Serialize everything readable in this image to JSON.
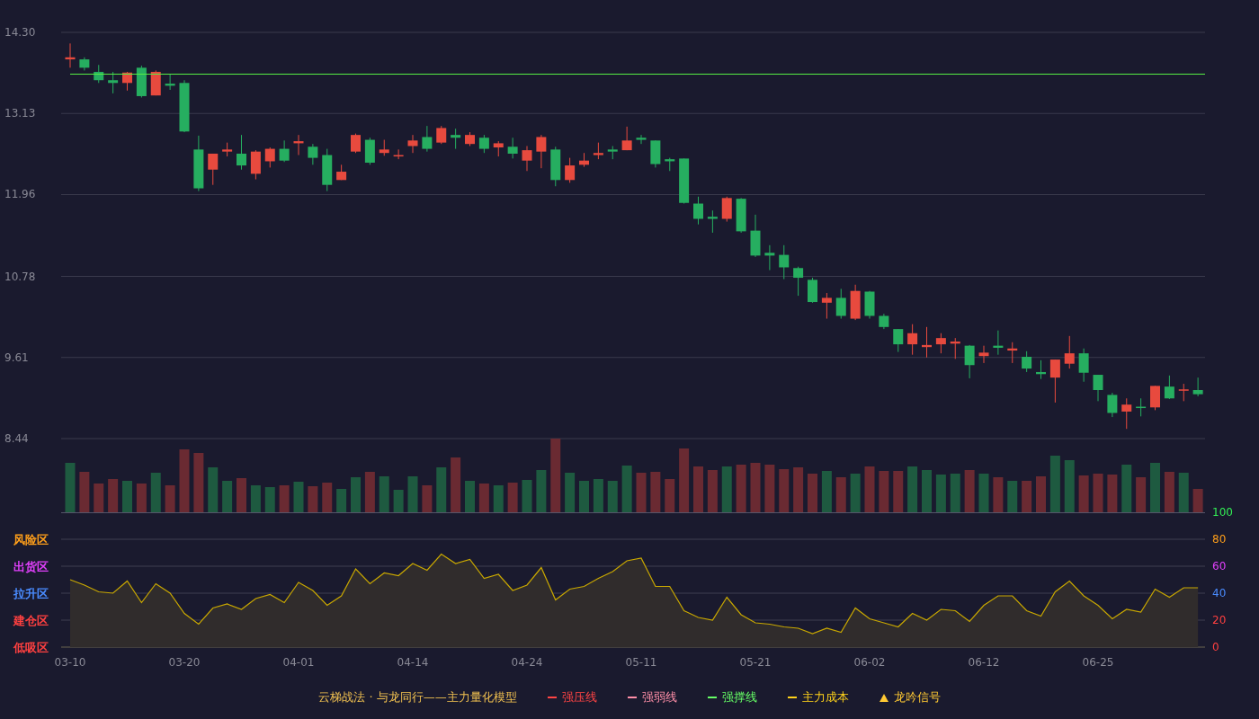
{
  "price_chart": {
    "chart_data": {
      "type": "candlestick",
      "grid": true,
      "ylim": [
        8.44,
        14.3
      ],
      "yticks": [
        {
          "value": 14.3,
          "label": "14.30"
        },
        {
          "value": 13.13,
          "label": "13.13"
        },
        {
          "value": 11.96,
          "label": "11.96"
        },
        {
          "value": 10.78,
          "label": "10.78"
        },
        {
          "value": 9.61,
          "label": "9.61"
        },
        {
          "value": 8.44,
          "label": "8.44"
        }
      ],
      "ohlc": [
        [
          13.91,
          14.14,
          13.79,
          13.94
        ],
        [
          13.91,
          13.94,
          13.75,
          13.79
        ],
        [
          13.73,
          13.83,
          13.57,
          13.61
        ],
        [
          13.61,
          13.73,
          13.42,
          13.57
        ],
        [
          13.57,
          13.73,
          13.46,
          13.72
        ],
        [
          13.79,
          13.82,
          13.36,
          13.38
        ],
        [
          13.39,
          13.75,
          13.39,
          13.73
        ],
        [
          13.56,
          13.69,
          13.47,
          13.53
        ],
        [
          13.57,
          13.61,
          12.86,
          12.87
        ],
        [
          12.61,
          12.81,
          12.01,
          12.05
        ],
        [
          12.32,
          12.55,
          12.1,
          12.55
        ],
        [
          12.58,
          12.71,
          12.51,
          12.61
        ],
        [
          12.55,
          12.82,
          12.32,
          12.38
        ],
        [
          12.26,
          12.6,
          12.18,
          12.58
        ],
        [
          12.44,
          12.64,
          12.35,
          12.62
        ],
        [
          12.62,
          12.74,
          12.43,
          12.45
        ],
        [
          12.7,
          12.82,
          12.53,
          12.73
        ],
        [
          12.65,
          12.69,
          12.39,
          12.49
        ],
        [
          12.53,
          12.62,
          12.01,
          12.1
        ],
        [
          12.17,
          12.39,
          12.17,
          12.29
        ],
        [
          12.58,
          12.84,
          12.56,
          12.82
        ],
        [
          12.75,
          12.78,
          12.39,
          12.42
        ],
        [
          12.56,
          12.75,
          12.52,
          12.61
        ],
        [
          12.51,
          12.61,
          12.47,
          12.53
        ],
        [
          12.66,
          12.82,
          12.56,
          12.74
        ],
        [
          12.79,
          12.95,
          12.58,
          12.62
        ],
        [
          12.71,
          12.95,
          12.69,
          12.92
        ],
        [
          12.82,
          12.91,
          12.62,
          12.78
        ],
        [
          12.69,
          12.86,
          12.66,
          12.82
        ],
        [
          12.78,
          12.82,
          12.56,
          12.62
        ],
        [
          12.64,
          12.73,
          12.51,
          12.7
        ],
        [
          12.65,
          12.78,
          12.48,
          12.55
        ],
        [
          12.45,
          12.66,
          12.3,
          12.6
        ],
        [
          12.58,
          12.82,
          12.34,
          12.79
        ],
        [
          12.61,
          12.65,
          12.08,
          12.17
        ],
        [
          12.17,
          12.49,
          12.13,
          12.38
        ],
        [
          12.39,
          12.56,
          12.36,
          12.45
        ],
        [
          12.53,
          12.71,
          12.47,
          12.56
        ],
        [
          12.61,
          12.66,
          12.47,
          12.58
        ],
        [
          12.6,
          12.94,
          12.6,
          12.74
        ],
        [
          12.78,
          12.82,
          12.69,
          12.75
        ],
        [
          12.74,
          12.74,
          12.35,
          12.4
        ],
        [
          12.47,
          12.49,
          12.3,
          12.44
        ],
        [
          12.48,
          12.48,
          11.83,
          11.84
        ],
        [
          11.83,
          11.93,
          11.53,
          11.61
        ],
        [
          11.64,
          11.73,
          11.41,
          11.61
        ],
        [
          11.61,
          11.93,
          11.57,
          11.91
        ],
        [
          11.9,
          11.91,
          11.41,
          11.43
        ],
        [
          11.44,
          11.67,
          11.06,
          11.08
        ],
        [
          11.12,
          11.23,
          10.87,
          11.08
        ],
        [
          11.09,
          11.23,
          10.74,
          10.91
        ],
        [
          10.9,
          10.92,
          10.5,
          10.76
        ],
        [
          10.73,
          10.76,
          10.4,
          10.41
        ],
        [
          10.4,
          10.54,
          10.17,
          10.47
        ],
        [
          10.47,
          10.6,
          10.17,
          10.21
        ],
        [
          10.17,
          10.66,
          10.15,
          10.57
        ],
        [
          10.56,
          10.57,
          10.17,
          10.21
        ],
        [
          10.21,
          10.24,
          10.02,
          10.05
        ],
        [
          10.02,
          10.02,
          9.69,
          9.8
        ],
        [
          9.8,
          10.09,
          9.65,
          9.96
        ],
        [
          9.76,
          10.05,
          9.61,
          9.79
        ],
        [
          9.8,
          9.96,
          9.67,
          9.89
        ],
        [
          9.81,
          9.89,
          9.59,
          9.84
        ],
        [
          9.78,
          9.79,
          9.31,
          9.5
        ],
        [
          9.63,
          9.78,
          9.53,
          9.68
        ],
        [
          9.78,
          10.0,
          9.65,
          9.75
        ],
        [
          9.71,
          9.83,
          9.53,
          9.74
        ],
        [
          9.62,
          9.7,
          9.4,
          9.45
        ],
        [
          9.4,
          9.57,
          9.3,
          9.37
        ],
        [
          9.32,
          9.58,
          8.96,
          9.58
        ],
        [
          9.52,
          9.92,
          9.45,
          9.67
        ],
        [
          9.67,
          9.74,
          9.26,
          9.39
        ],
        [
          9.36,
          9.36,
          8.98,
          9.14
        ],
        [
          9.07,
          9.1,
          8.75,
          8.81
        ],
        [
          8.83,
          9.02,
          8.58,
          8.93
        ],
        [
          8.9,
          9.02,
          8.76,
          8.88
        ],
        [
          8.89,
          9.2,
          8.85,
          9.2
        ],
        [
          9.19,
          9.35,
          9.01,
          9.02
        ],
        [
          9.13,
          9.23,
          8.98,
          9.15
        ],
        [
          9.14,
          9.32,
          9.05,
          9.08
        ]
      ]
    }
  },
  "indicator_chart": {
    "zones": [
      {
        "label": "风险区",
        "color": "#ff9f1a"
      },
      {
        "label": "出货区",
        "color": "#e040fb"
      },
      {
        "label": "拉升区",
        "color": "#4a8cff"
      },
      {
        "label": "建仓区",
        "color": "#ff4040"
      },
      {
        "label": "低吸区",
        "color": "#ff4040"
      }
    ],
    "tick_styles": [
      {
        "color": "#33ee55"
      },
      {
        "color": "#ff9f1a"
      },
      {
        "color": "#e040fb"
      },
      {
        "color": "#4a8cff"
      },
      {
        "color": "#ff4040"
      },
      {
        "color": "#ff4040"
      }
    ],
    "dates": [
      "03-10",
      "03-20",
      "04-01",
      "04-14",
      "04-24",
      "05-11",
      "05-21",
      "06-02",
      "06-12",
      "06-25"
    ],
    "chart_data": {
      "type": "area",
      "grid": true,
      "ylim": [
        0,
        100
      ],
      "yticks": [
        {
          "value": 100,
          "label": "100"
        },
        {
          "value": 80,
          "label": "80"
        },
        {
          "value": 60,
          "label": "60"
        },
        {
          "value": 40,
          "label": "40"
        },
        {
          "value": 20,
          "label": "20"
        },
        {
          "value": 0,
          "label": "0"
        }
      ],
      "series": [
        {
          "color": "#c9a800",
          "values": [
            50,
            46,
            41,
            40,
            49,
            33,
            47,
            40,
            25,
            17,
            29,
            32,
            28,
            36,
            39,
            33,
            48,
            42,
            31,
            38,
            58,
            47,
            55,
            53,
            62,
            57,
            69,
            62,
            65,
            51,
            54,
            42,
            46,
            59,
            35,
            43,
            45,
            51,
            56,
            64,
            66,
            45,
            45,
            27,
            22,
            20,
            37,
            24,
            18,
            17,
            15,
            14,
            10,
            14,
            11,
            29,
            21,
            18,
            15,
            25,
            20,
            28,
            27,
            19,
            31,
            38,
            38,
            27,
            23,
            41,
            49,
            38,
            31,
            21,
            28,
            26,
            43,
            37,
            44,
            44
          ]
        }
      ]
    }
  },
  "legend": {
    "title": "云梯战法 · 与龙同行——主力量化模型",
    "items": [
      {
        "label": "强压线",
        "kind": "solid",
        "color": "#ff4444"
      },
      {
        "label": "强弱线",
        "kind": "dashed",
        "color": "#ff8fa8"
      },
      {
        "label": "强撑线",
        "kind": "solid",
        "color": "#66ff66"
      },
      {
        "label": "主力成本",
        "kind": "dashed",
        "color": "#ffd21a"
      },
      {
        "label": "龙吟信号",
        "kind": "triangle",
        "color": "#ffc933"
      }
    ]
  }
}
